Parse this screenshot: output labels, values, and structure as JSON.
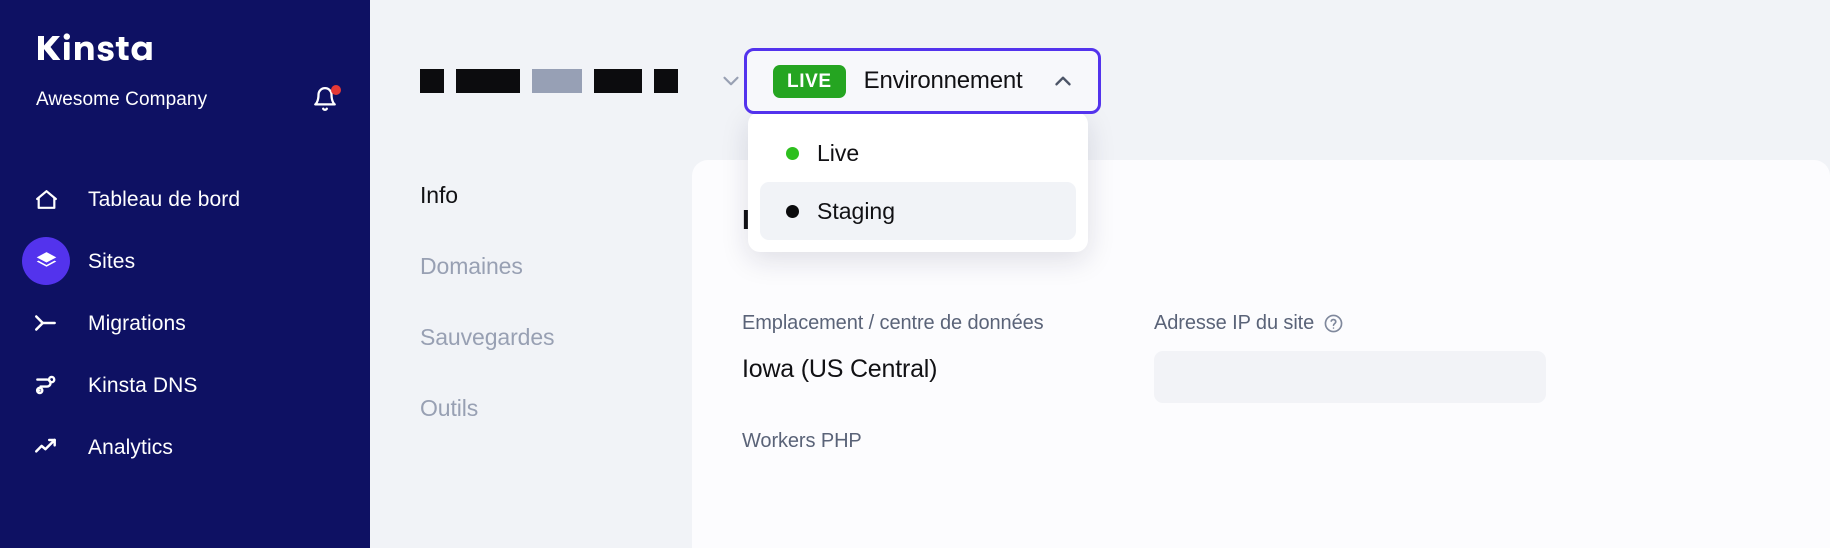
{
  "sidebar": {
    "logo_text": "Kinsta",
    "org_name": "Awesome Company",
    "notification_icon": "bell-icon",
    "has_notification_dot": true,
    "items": [
      {
        "label": "Tableau de bord",
        "icon": "home-icon",
        "active": false
      },
      {
        "label": "Sites",
        "icon": "layers-icon",
        "active": true
      },
      {
        "label": "Migrations",
        "icon": "migration-arrow-icon",
        "active": false
      },
      {
        "label": "Kinsta DNS",
        "icon": "dns-nodes-icon",
        "active": false
      },
      {
        "label": "Analytics",
        "icon": "trending-up-icon",
        "active": false
      }
    ]
  },
  "topbar": {
    "site_name_redacted": true,
    "site_chevron_icon": "chevron-down-icon"
  },
  "environment_selector": {
    "badge_label": "LIVE",
    "label": "Environnement",
    "caret_icon": "chevron-up-icon",
    "expanded": true,
    "options": [
      {
        "label": "Live",
        "dot_color": "#2DBF1E",
        "hovered": false
      },
      {
        "label": "Staging",
        "dot_color": "#0B0B0D",
        "hovered": true
      }
    ]
  },
  "subnav": {
    "items": [
      {
        "label": "Info",
        "active": true
      },
      {
        "label": "Domaines",
        "active": false
      },
      {
        "label": "Sauvegardes",
        "active": false
      },
      {
        "label": "Outils",
        "active": false
      }
    ]
  },
  "panel": {
    "heading": "Info",
    "fields": [
      {
        "label": "Emplacement / centre de données",
        "value": "Iowa (US Central)"
      },
      {
        "label": "Adresse IP du site",
        "help_icon": "question-circle-icon",
        "value_placeholder_skeleton": true
      },
      {
        "label": "Workers PHP"
      }
    ]
  },
  "colors": {
    "sidebar_bg": "#0E1163",
    "accent_purple": "#5333ED",
    "live_green": "#25A521",
    "page_bg": "#F1F3F7",
    "panel_bg": "#FCFCFE",
    "notification_red": "#E53935",
    "muted_text": "#98A0B3"
  }
}
